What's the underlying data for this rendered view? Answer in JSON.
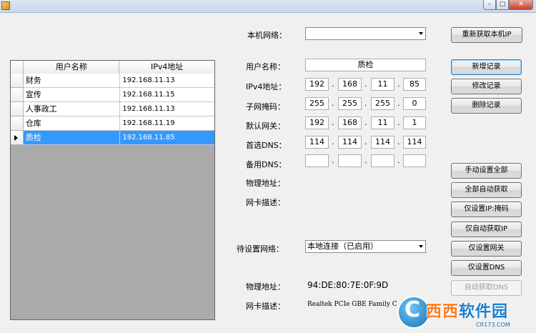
{
  "window": {
    "min": "–",
    "max": "□",
    "close": "✕"
  },
  "local_network": {
    "label": "本机网络：",
    "value": ""
  },
  "refresh_button": "重新获取本机IP",
  "grid": {
    "columns": [
      "用户名称",
      "IPv4地址"
    ],
    "rows": [
      {
        "name": "财务",
        "ip": "192.168.11.13"
      },
      {
        "name": "宣传",
        "ip": "192.168.11.15"
      },
      {
        "name": "人事政工",
        "ip": "192.168.11.13"
      },
      {
        "name": "仓库",
        "ip": "192.168.11.19"
      },
      {
        "name": "质检",
        "ip": "192.168.11.85"
      }
    ]
  },
  "form": {
    "username_label": "用户名称：",
    "username": "质检",
    "ipv4_label": "IPv4地址：",
    "ipv4": [
      "192",
      "168",
      "11",
      "85"
    ],
    "mask_label": "子网掩码：",
    "mask": [
      "255",
      "255",
      "255",
      "0"
    ],
    "gateway_label": "默认网关：",
    "gateway": [
      "192",
      "168",
      "11",
      "1"
    ],
    "dns1_label": "首选DNS：",
    "dns1": [
      "114",
      "114",
      "114",
      "114"
    ],
    "dns2_label": "备用DNS：",
    "dns2": [
      "",
      "",
      "",
      ""
    ],
    "mac_label": "物理地址：",
    "mac": "",
    "desc_label": "网卡描述：",
    "desc": ""
  },
  "record_buttons": {
    "add": "新增记录",
    "edit": "修改记录",
    "delete": "删除记录"
  },
  "action_buttons": {
    "manual_all": "手动设置全部",
    "auto_all": "全部自动获取",
    "set_ip_mask": "仅设置IP:掩码",
    "auto_ip": "仅自动获取IP",
    "set_gateway": "仅设置网关",
    "set_dns": "仅设置DNS",
    "auto_dns": "自动获取DNS"
  },
  "target_network": {
    "label": "待设置网络：",
    "value": "本地连接（已启用）"
  },
  "current": {
    "mac_label": "物理地址：",
    "mac": "94:DE:80:7E:0F:9D",
    "desc_label": "网卡描述：",
    "desc": "Realtek PCIe GBE Family Controller"
  },
  "watermark": {
    "c": "C",
    "brand_a": "西西",
    "brand_b": "软件园",
    "url": "CR173.COM"
  }
}
